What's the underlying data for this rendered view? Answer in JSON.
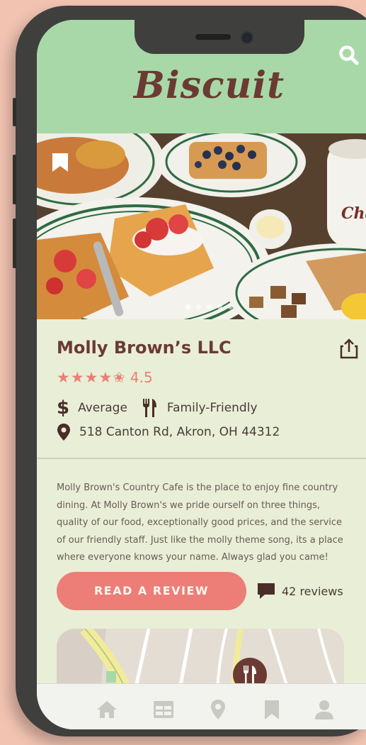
{
  "app": {
    "logo": "Biscuit"
  },
  "restaurant": {
    "name": "Molly Brown’s LLC",
    "stars": "★★★★✬",
    "rating": "4.5",
    "price_symbol": "$",
    "price_label": "Average",
    "category": "Family-Friendly",
    "address": "518 Canton Rd, Akron, OH 44312",
    "description": "Molly Brown's Country Cafe is the place to enjoy fine country dining. At Molly Brown's we pride ourself on three things, quality of our food, exceptionally good prices, and the service of our friendly staff. Just like the molly theme song, its a place where everyone knows your name. Always glad you came!"
  },
  "actions": {
    "read_review": "READ A REVIEW",
    "reviews_count": "42 reviews"
  },
  "photo": {
    "mug_text": "Char"
  },
  "gallery": {
    "dots": 5,
    "active": 0
  },
  "tabs": [
    "home",
    "menu",
    "location",
    "saved",
    "profile"
  ],
  "colors": {
    "header": "#a9d8a8",
    "background": "#e8efd6",
    "brand": "#6b3a33",
    "accent": "#ec7e77",
    "tab_icon": "#c9c9c4"
  },
  "icons": {
    "search": "search-icon",
    "bookmark": "bookmark-icon",
    "share": "share-icon",
    "price": "dollar-icon",
    "category": "fork-knife-icon",
    "address": "map-pin-icon",
    "reviews": "chat-bubble-icon",
    "map_marker": "restaurant-marker-icon"
  }
}
